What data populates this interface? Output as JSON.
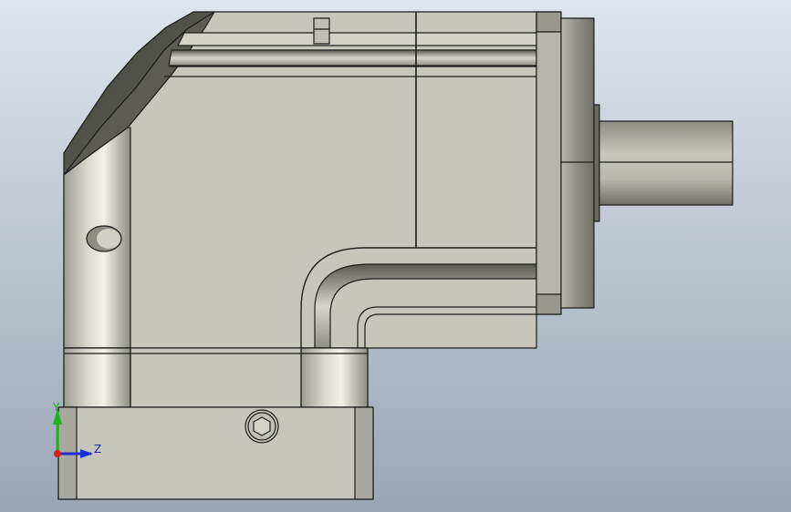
{
  "viewport": {
    "background_top": "#dfe4ec",
    "background_bottom": "#9aa5b6",
    "model": "right-angle-gearbox"
  },
  "triad": {
    "y_label": "Y",
    "z_label": "Z",
    "y_color": "#1fb51f",
    "z_color": "#1e2fd6",
    "x_color": "#d41f1f"
  },
  "colors": {
    "body": "#c6c6bc",
    "body_shade": "#a9a99f",
    "edge": "#1d1d1d",
    "dark": "#4a4a44"
  }
}
